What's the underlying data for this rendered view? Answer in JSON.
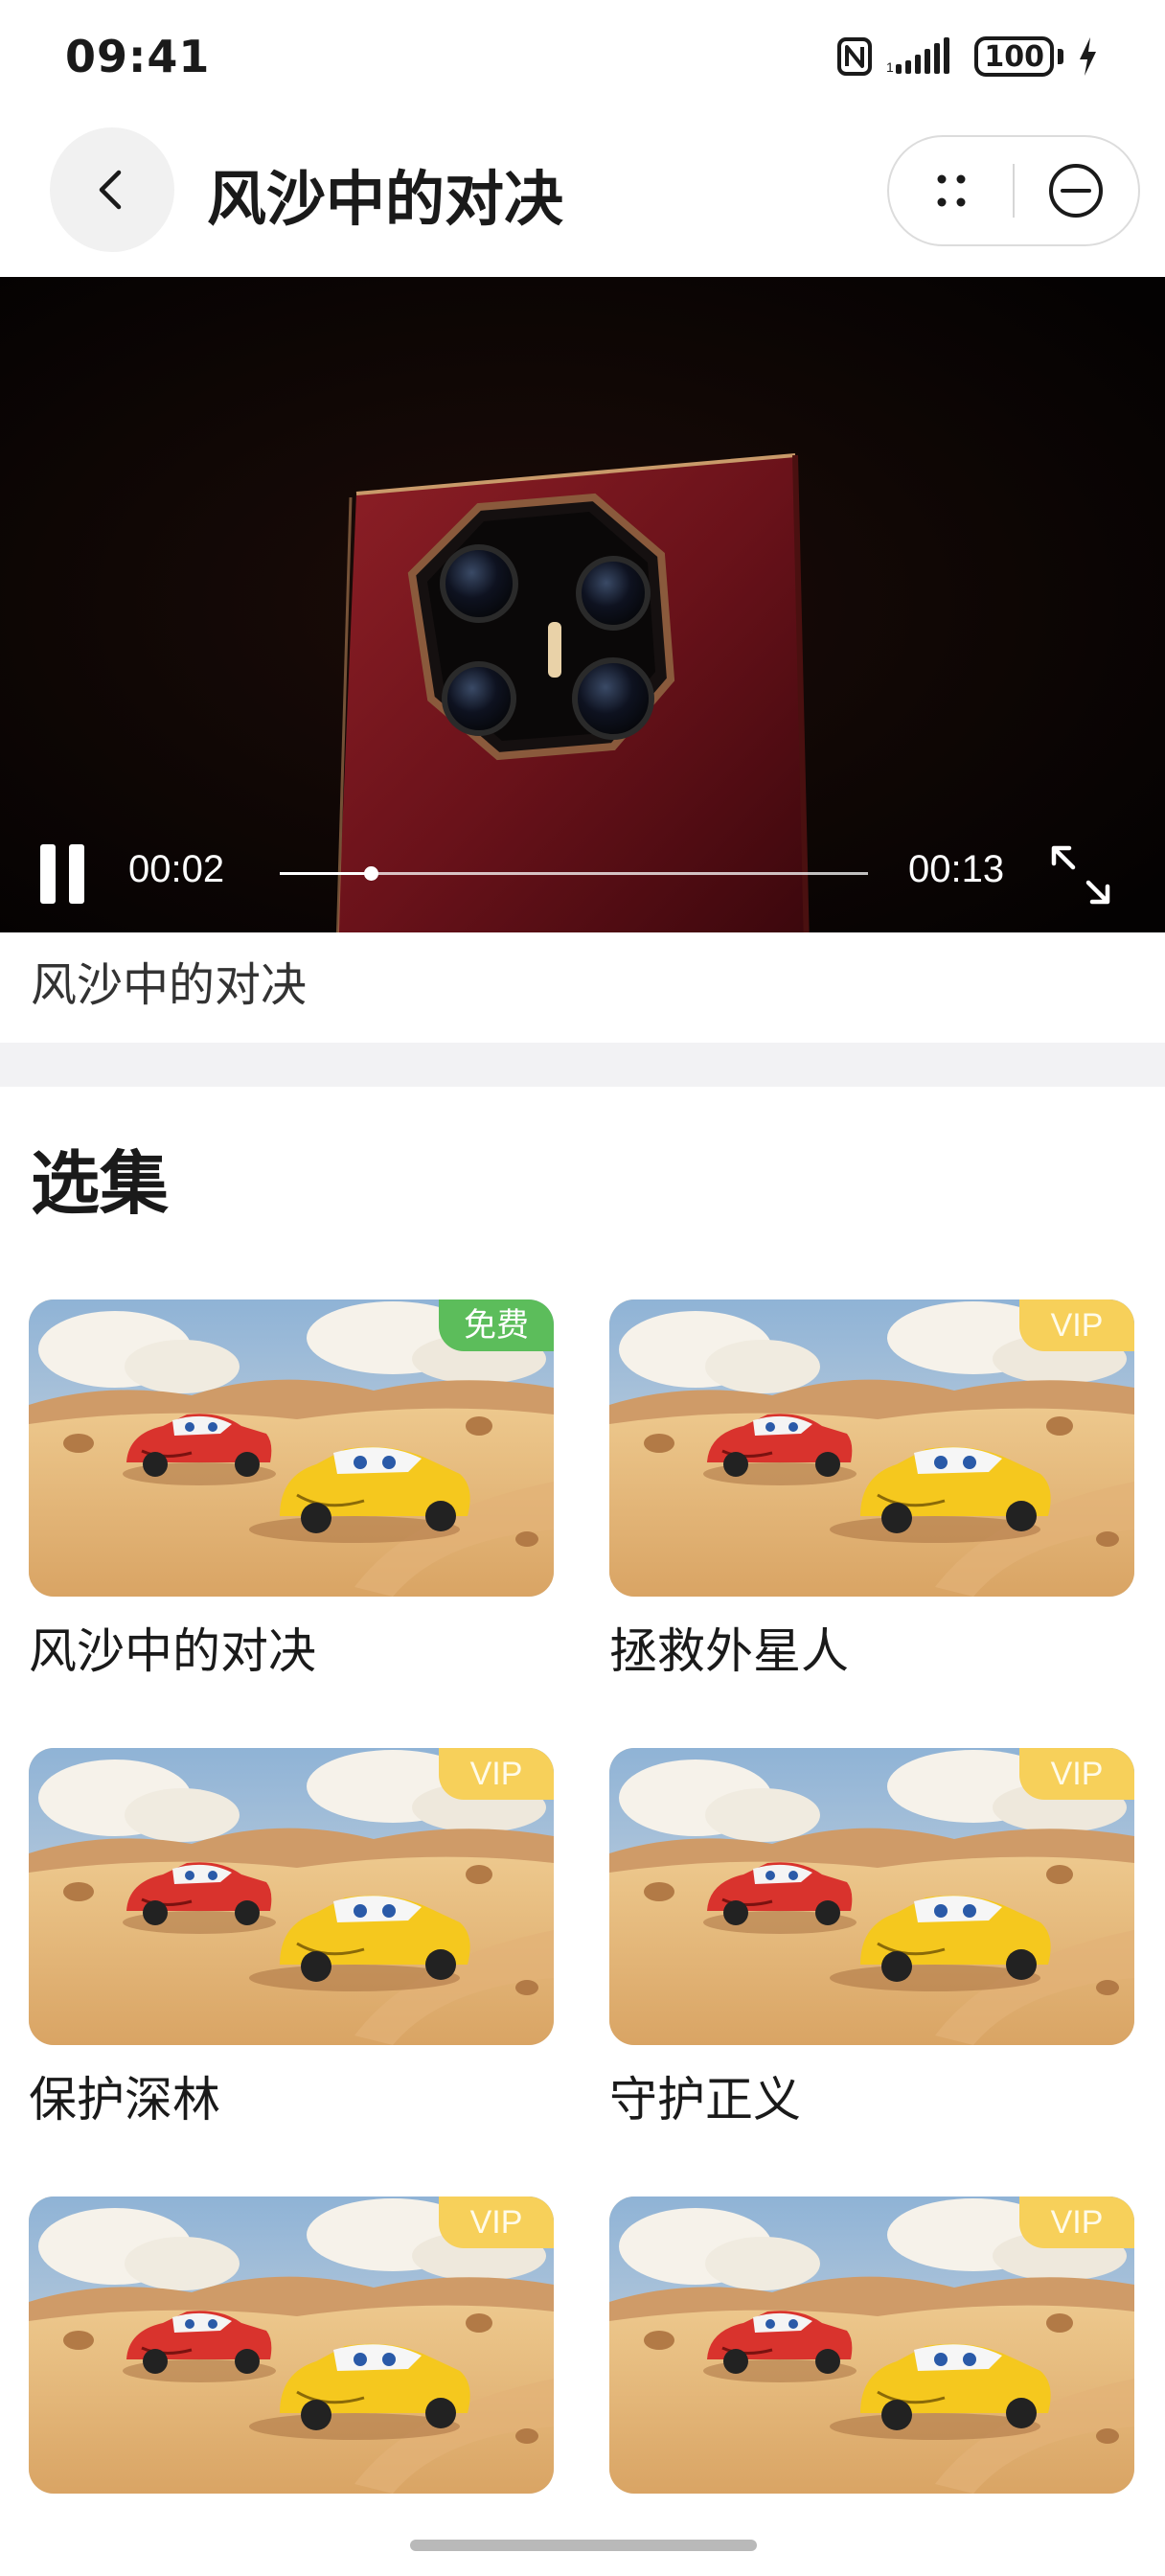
{
  "status_bar": {
    "time": "09:41",
    "battery": "100",
    "icons": [
      "nfc-icon",
      "signal-icon",
      "battery-icon",
      "charging-bolt-icon"
    ]
  },
  "header": {
    "title": "风沙中的对决",
    "back_icon": "chevron-left-icon",
    "more_icon": "dots-grid-icon",
    "close_icon": "minus-circle-icon"
  },
  "player": {
    "current_time": "00:02",
    "total_time": "00:13",
    "progress": 0.154,
    "state_icon": "pause-icon",
    "fullscreen_icon": "expand-icon"
  },
  "video_caption": "风沙中的对决",
  "episodes_section": {
    "title": "选集",
    "episodes": [
      {
        "title": "风沙中的对决",
        "badge": "免费",
        "badge_type": "free"
      },
      {
        "title": "拯救外星人",
        "badge": "VIP",
        "badge_type": "vip"
      },
      {
        "title": "保护深林",
        "badge": "VIP",
        "badge_type": "vip"
      },
      {
        "title": "守护正义",
        "badge": "VIP",
        "badge_type": "vip"
      },
      {
        "title": "",
        "badge": "VIP",
        "badge_type": "vip"
      },
      {
        "title": "",
        "badge": "VIP",
        "badge_type": "vip"
      }
    ]
  },
  "colors": {
    "free_badge": "#5cbd5b",
    "vip_badge": "#f7d05a",
    "separator": "#f2f2f4",
    "video_bg": "#050303"
  }
}
